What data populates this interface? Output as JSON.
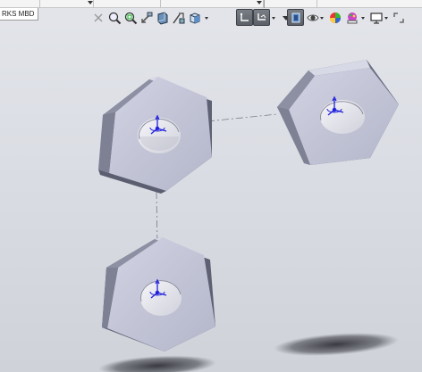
{
  "document_tab": {
    "label": "RKS MBD"
  },
  "toolbar": {
    "icons": [
      "close-x-icon",
      "zoom-to-fit-icon",
      "zoom-to-area-icon",
      "previous-view-icon",
      "section-view-icon",
      "dynamic-annotation-views-icon",
      "view-orientation-icon",
      "display-style-icon",
      "hide-show-items-icon",
      "edit-appearance-icon",
      "apply-scene-icon",
      "view-settings-icon"
    ]
  },
  "viewport": {
    "parts": [
      {
        "name": "hex-nut-1"
      },
      {
        "name": "hex-nut-2"
      },
      {
        "name": "hex-nut-3"
      }
    ],
    "colors": {
      "face_light": "#c4c6d8",
      "face_side": "#7e8194",
      "face_dark": "#5e6174",
      "hole": "#e8e9ef",
      "triad_blue": "#2222dd"
    }
  }
}
